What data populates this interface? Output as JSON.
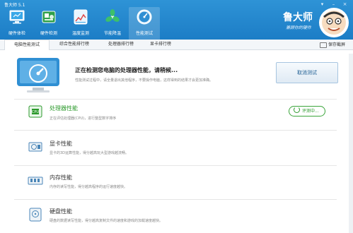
{
  "app": {
    "title": "鲁大师 5.1",
    "brand": "鲁大师",
    "slogan": "兼顾你的硬件"
  },
  "nav": [
    {
      "label": "硬件体检",
      "icon": "monitor-icon"
    },
    {
      "label": "硬件检测",
      "icon": "chip-icon"
    },
    {
      "label": "温度监测",
      "icon": "thermometer-icon"
    },
    {
      "label": "节能降温",
      "icon": "fan-icon"
    },
    {
      "label": "性能测试",
      "icon": "speedometer-icon"
    }
  ],
  "tabs": [
    "电脑性能测试",
    "综合性能排行榜",
    "处理器排行榜",
    "显卡排行榜"
  ],
  "save_label": "保存截屏",
  "hero": {
    "title": "正在检测您电脑的处理器性能，请稍候...",
    "desc": "性能测试过程中，请全量退出其他程序，不要操作电脑，这样得到的结果才会更加准确。",
    "cancel_label": "取消测试"
  },
  "items": [
    {
      "title": "处理器性能",
      "desc": "正在评估处理器(CPU)，进行整型数字排序",
      "status": "评测中..."
    },
    {
      "title": "显卡性能",
      "desc": "显卡的3D运算性能，得分越高玩大型游戏越流畅。"
    },
    {
      "title": "内存性能",
      "desc": "内存的读写性能，得分越高程序的运行速度越快。"
    },
    {
      "title": "硬盘性能",
      "desc": "硬盘的数据读写性能，得分越高复制文件的速度和游戏的加载速度越快。"
    }
  ],
  "colors": {
    "topbar": "#1c7dc6",
    "accent_green": "#2c9a2c",
    "button_text": "#1d5d93"
  }
}
